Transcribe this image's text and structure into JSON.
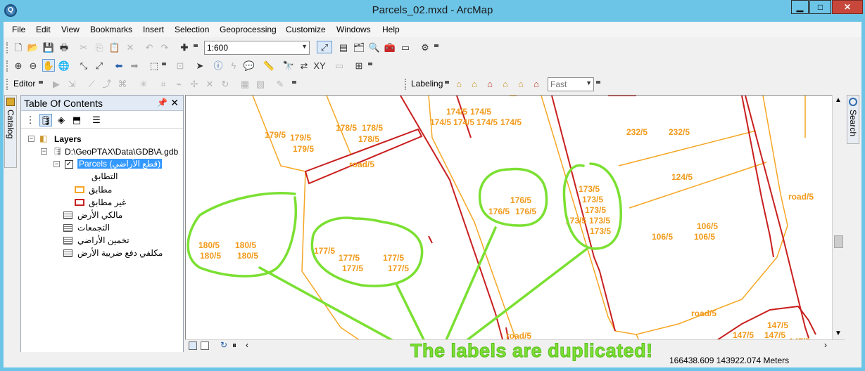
{
  "window": {
    "title": "Parcels_02.mxd - ArcMap",
    "app_icon": "Q",
    "minimize": "▁",
    "maximize": "□",
    "close": "✕"
  },
  "menubar": [
    "File",
    "Edit",
    "View",
    "Bookmarks",
    "Insert",
    "Selection",
    "Geoprocessing",
    "Customize",
    "Windows",
    "Help"
  ],
  "toolbar": {
    "scale": "1:600",
    "editor_label": "Editor",
    "labeling_label": "Labeling",
    "quality": "Fast"
  },
  "toc": {
    "title": "Table Of Contents",
    "layers_label": "Layers",
    "gdb_path": "D:\\GeoPTAX\\Data\\GDB\\A.gdb",
    "parcels_label": "Parcels (قطع الأراضي)",
    "symbology_heading": "التطابق",
    "legend_match": "مطابق",
    "legend_mismatch": "غير مطابق",
    "tables": [
      "مالكي الأرض",
      "التجمعات",
      "تخمين الأراضي",
      "مكلفي دفع ضريبة الأرض"
    ]
  },
  "side_tabs": {
    "catalog": "Catalog",
    "search": "Search"
  },
  "map": {
    "colors": {
      "matched": "#f5a623",
      "mismatched": "#c91f1f",
      "label": "#f19a1a",
      "annotation": "#7be032"
    },
    "labels": [
      "179/5",
      "179/5",
      "179/5",
      "178/5",
      "178/5",
      "178/5",
      "road/5",
      "174/5",
      "174/5",
      "174/5",
      "174/5",
      "174/5",
      "174/5",
      "232/5",
      "232/5",
      "124/5",
      "road/5",
      "180/5",
      "180/5",
      "180/5",
      "180/5",
      "177/5",
      "177/5",
      "177/5",
      "177/5",
      "177/5",
      "176/5",
      "176/5",
      "176/5",
      "173/5",
      "173/5",
      "173/5",
      "173/5",
      "173/5",
      "173/5",
      "106/5",
      "106/5",
      "106/5",
      "road/5",
      "road/5",
      "147/5",
      "147/5",
      "147/5",
      "147/5"
    ]
  },
  "status": {
    "coordinates": "166438.609  143922.074 Meters"
  },
  "annotation": "The labels are duplicated!"
}
